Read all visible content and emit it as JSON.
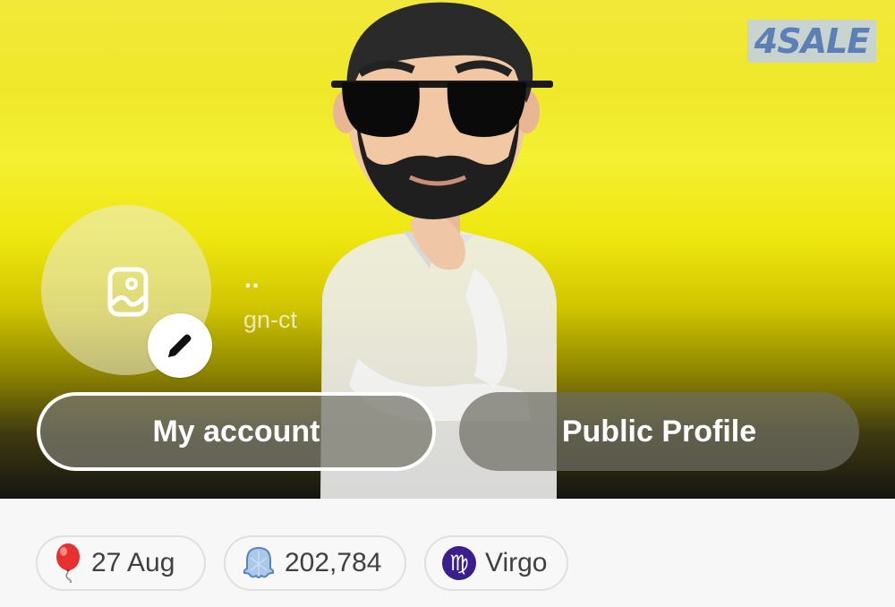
{
  "watermark": "4SALE",
  "profile": {
    "display_name": "..",
    "username": "gn-ct"
  },
  "buttons": {
    "my_account": "My account",
    "public_profile": "Public Profile"
  },
  "stats": {
    "birthday": "27 Aug",
    "snap_score": "202,784",
    "zodiac": "Virgo"
  },
  "icons": {
    "avatar_placeholder": "image-icon",
    "edit": "pencil-icon",
    "birthday": "balloon-icon",
    "score": "ghost-icon",
    "zodiac": "virgo-icon"
  },
  "colors": {
    "hero_top": "#f2e83a",
    "hero_bottom": "#151510",
    "zodiac_badge": "#3b1e8c",
    "balloon": "#e8302f",
    "ghost": "#7fa9d8"
  }
}
